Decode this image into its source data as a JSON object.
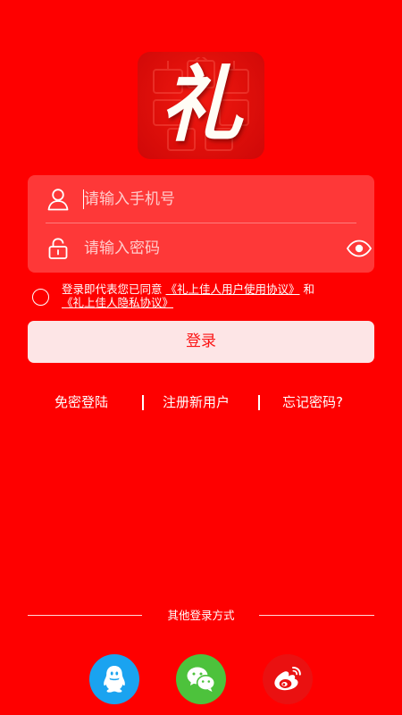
{
  "logo": {
    "char": "礼",
    "icon": "gift-logo-icon"
  },
  "form": {
    "phone": {
      "placeholder": "请输入手机号",
      "icon": "user-icon"
    },
    "password": {
      "placeholder": "请输入密码",
      "icon": "lock-icon",
      "toggle_icon": "eye-icon"
    }
  },
  "agreement": {
    "prefix": "登录即代表您已同意",
    "user_agreement": "《礼上佳人用户使用协议》",
    "and": "和",
    "privacy_policy": "《礼上佳人隐私协议》"
  },
  "login_button": "登录",
  "links": {
    "passwordless": "免密登陆",
    "register": "注册新用户",
    "forgot": "忘记密码?"
  },
  "other_login": {
    "label": "其他登录方式",
    "providers": [
      {
        "name": "QQ",
        "icon": "qq-icon",
        "color": "#1aa3f0"
      },
      {
        "name": "WeChat",
        "icon": "wechat-icon",
        "color": "#4dc23c"
      },
      {
        "name": "Weibo",
        "icon": "weibo-icon",
        "color": "#ea1111"
      }
    ]
  },
  "colors": {
    "background": "#fe0000",
    "button_bg": "#fde5e6",
    "button_text": "#fb1414"
  }
}
